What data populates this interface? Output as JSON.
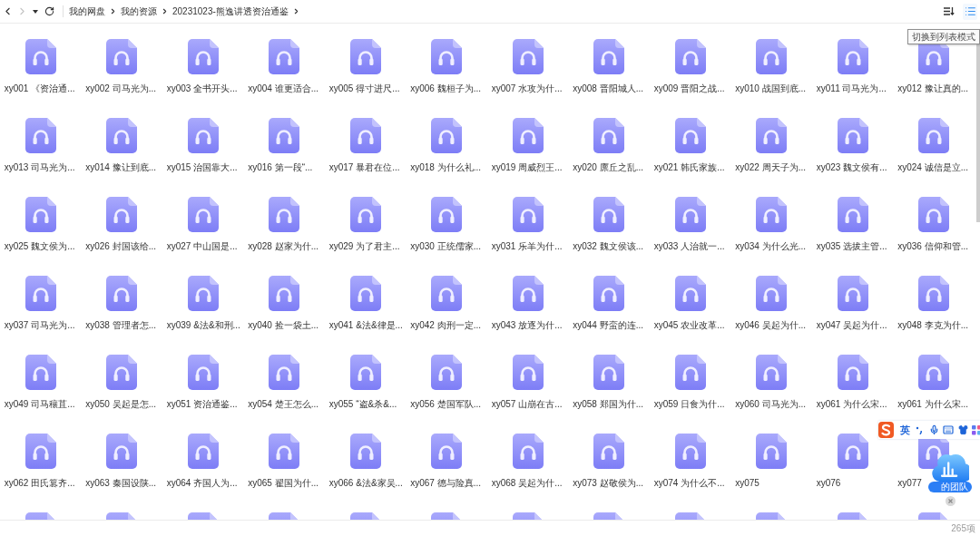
{
  "nav_buttons": [
    {
      "kind": "back",
      "disabled": false
    },
    {
      "kind": "forward",
      "disabled": true
    },
    {
      "kind": "history",
      "disabled": false
    },
    {
      "kind": "refresh",
      "disabled": false
    }
  ],
  "breadcrumb": [
    "我的网盘",
    "我的资源",
    "20231023-熊逸讲透资治通鉴"
  ],
  "view_buttons": [
    {
      "kind": "sort",
      "hovered": false
    },
    {
      "kind": "list",
      "hovered": true,
      "tooltip": "切换到列表模式"
    }
  ],
  "files": [
    {
      "name": "xy001 《资治通...",
      "selected": false
    },
    {
      "name": "xy002 司马光为...",
      "selected": false
    },
    {
      "name": "xy003 全书开头...",
      "selected": false
    },
    {
      "name": "xy004 谁更适合...",
      "selected": false
    },
    {
      "name": "xy005 得寸进尺...",
      "selected": false
    },
    {
      "name": "xy006 魏桓子为...",
      "selected": false
    },
    {
      "name": "xy007 水攻为什...",
      "selected": false
    },
    {
      "name": "xy008 晋阳城人...",
      "selected": false
    },
    {
      "name": "xy009 晋阳之战...",
      "selected": false
    },
    {
      "name": "xy010 战国到底...",
      "selected": false
    },
    {
      "name": "xy011 司马光为...",
      "selected": false
    },
    {
      "name": "xy012 豫让真的...",
      "selected": false
    },
    {
      "name": "xy013 司马光为...",
      "selected": false
    },
    {
      "name": "xy014 豫让到底...",
      "selected": false
    },
    {
      "name": "xy015 治国靠大...",
      "selected": false
    },
    {
      "name": "xy016 第一段“...",
      "selected": false
    },
    {
      "name": "xy017 暴君在位...",
      "selected": false
    },
    {
      "name": "xy018 为什么礼...",
      "selected": false
    },
    {
      "name": "xy019 周威烈王...",
      "selected": false
    },
    {
      "name": "xy020 廪丘之乱...",
      "selected": false
    },
    {
      "name": "xy021 韩氏家族...",
      "selected": false
    },
    {
      "name": "xy022 周天子为...",
      "selected": false
    },
    {
      "name": "xy023 魏文侯有...",
      "selected": false
    },
    {
      "name": "xy024 诚信是立...",
      "selected": false
    },
    {
      "name": "xy025 魏文侯为...",
      "selected": false
    },
    {
      "name": "xy026 封国该给...",
      "selected": false
    },
    {
      "name": "xy027 中山国是...",
      "selected": false
    },
    {
      "name": "xy028 赵家为什...",
      "selected": false
    },
    {
      "name": "xy029 为了君主...",
      "selected": false
    },
    {
      "name": "xy030 正统儒家...",
      "selected": false
    },
    {
      "name": "xy031 乐羊为什...",
      "selected": false
    },
    {
      "name": "xy032 魏文侯该...",
      "selected": false
    },
    {
      "name": "xy033 人治就一...",
      "selected": false
    },
    {
      "name": "xy034 为什么光...",
      "selected": false
    },
    {
      "name": "xy035 选拔主管...",
      "selected": false
    },
    {
      "name": "xy036 信仰和管...",
      "selected": false
    },
    {
      "name": "xy037 司马光为...",
      "selected": false
    },
    {
      "name": "xy038 管理者怎...",
      "selected": false
    },
    {
      "name": "xy039 &法&和刑...",
      "selected": false
    },
    {
      "name": "xy040 捡一袋土...",
      "selected": false
    },
    {
      "name": "xy041 &法&律是...",
      "selected": false
    },
    {
      "name": "xy042 肉刑一定...",
      "selected": false
    },
    {
      "name": "xy043 放逐为什...",
      "selected": false
    },
    {
      "name": "xy044 野蛮的连...",
      "selected": false
    },
    {
      "name": "xy045 农业改革...",
      "selected": false
    },
    {
      "name": "xy046 吴起为什...",
      "selected": false
    },
    {
      "name": "xy047 吴起为什...",
      "selected": false
    },
    {
      "name": "xy048 李克为什...",
      "selected": false
    },
    {
      "name": "xy049 司马穰苴...",
      "selected": false
    },
    {
      "name": "xy050 吴起是怎...",
      "selected": false
    },
    {
      "name": "xy051 资治通鉴...",
      "selected": false
    },
    {
      "name": "xy054 楚王怎么...",
      "selected": false
    },
    {
      "name": "xy055 “盗&杀&...",
      "selected": false
    },
    {
      "name": "xy056 楚国军队...",
      "selected": false
    },
    {
      "name": "xy057 山崩在古...",
      "selected": false
    },
    {
      "name": "xy058 郑国为什...",
      "selected": false
    },
    {
      "name": "xy059 日食为什...",
      "selected": false
    },
    {
      "name": "xy060 司马光为...",
      "selected": false
    },
    {
      "name": "xy061 为什么宋...",
      "selected": false
    },
    {
      "name": "xy061 为什么宋...",
      "selected": false
    },
    {
      "name": "xy062 田氏篡齐...",
      "selected": false
    },
    {
      "name": "xy063 秦国设陕...",
      "selected": false
    },
    {
      "name": "xy064 齐国人为...",
      "selected": false
    },
    {
      "name": "xy065 翟国为什...",
      "selected": false
    },
    {
      "name": "xy066 &法&家吴...",
      "selected": false
    },
    {
      "name": "xy067 德与险真...",
      "selected": false
    },
    {
      "name": "xy068 吴起为什...",
      "selected": false
    },
    {
      "name": "xy073 赵敬侯为...",
      "selected": false
    },
    {
      "name": "xy074 为什么不...",
      "selected": false
    },
    {
      "name": "xy075",
      "selected": false
    },
    {
      "name": "xy076",
      "selected": false
    },
    {
      "name": "xy077",
      "selected": false
    }
  ],
  "status_bar": {
    "count": "265项"
  },
  "ime_toolbar": {
    "mode": "英"
  },
  "floating_widget": {
    "label": "的团队"
  }
}
